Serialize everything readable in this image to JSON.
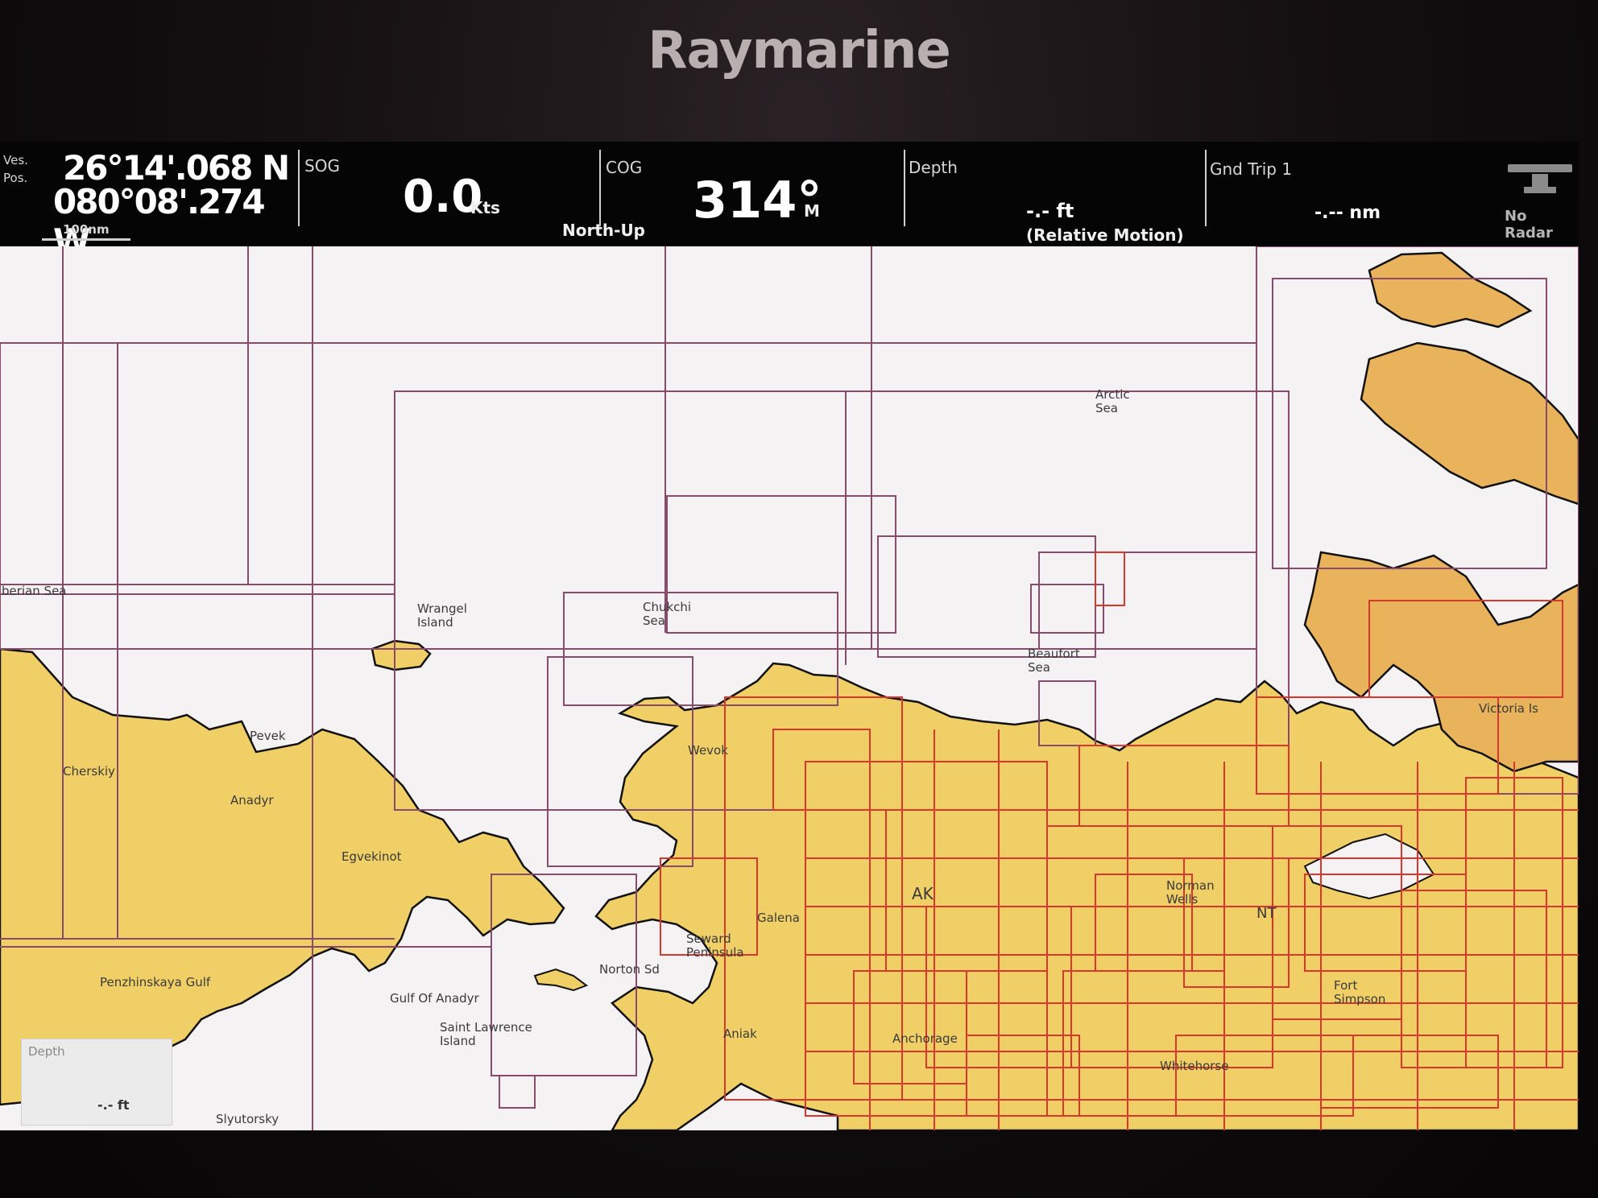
{
  "brand": "Raymarine",
  "databar": {
    "pos_label": "Ves.\nPos.",
    "latitude": "26°14'.068 N",
    "longitude": "080°08'.274 W",
    "scale": "100nm",
    "sog_label": "SOG",
    "sog_value": "0.0",
    "sog_unit": "Kts",
    "orientation": "North-Up",
    "cog_label": "COG",
    "cog_value": "314°",
    "cog_unit": "M",
    "depth_label": "Depth",
    "depth_value": "-.- ft",
    "motion_mode": "(Relative Motion)",
    "trip_label": "Gnd Trip 1",
    "trip_value": "-.-- nm",
    "radar_status": "No Radar"
  },
  "map": {
    "colors": {
      "water": "#f4f2f3",
      "land": "#f1cf67",
      "land_dark": "#e8b35a",
      "chart_border_major": "#8a4a6b",
      "chart_border_detail": "#d9372c"
    },
    "place_labels": {
      "arctic_sea": "Arctic\nSea",
      "siberian_sea": "berian Sea",
      "wrangel": "Wrangel\nIsland",
      "chukchi": "Chukchi\nSea",
      "beaufort": "Beaufort\nSea",
      "pevek": "Pevek",
      "chersky": "Cherskiy",
      "anadyr": "Anadyr",
      "egvekinot": "Egvekinot",
      "wevok": "Wevok",
      "ak": "AK",
      "galena": "Galena",
      "norton_sd": "Norton Sd",
      "seward": "Seward\nPeninsula",
      "pendzhinskaya": "Penzhinskaya Gulf",
      "gulf_anadyr": "Gulf Of Anadyr",
      "saint_lawrence": "Saint Lawrence\nIsland",
      "aniak": "Aniak",
      "anchorage": "Anchorage",
      "norman_wells": "Norman\nWells",
      "nt": "NT",
      "victoria": "Victoria Is",
      "fort_simpson": "Fort\nSimpson",
      "whitehorse": "Whitehorse",
      "slyutorsky": "Slyutorsky"
    },
    "depth_box": {
      "label": "Depth",
      "value": "-.- ft"
    }
  }
}
